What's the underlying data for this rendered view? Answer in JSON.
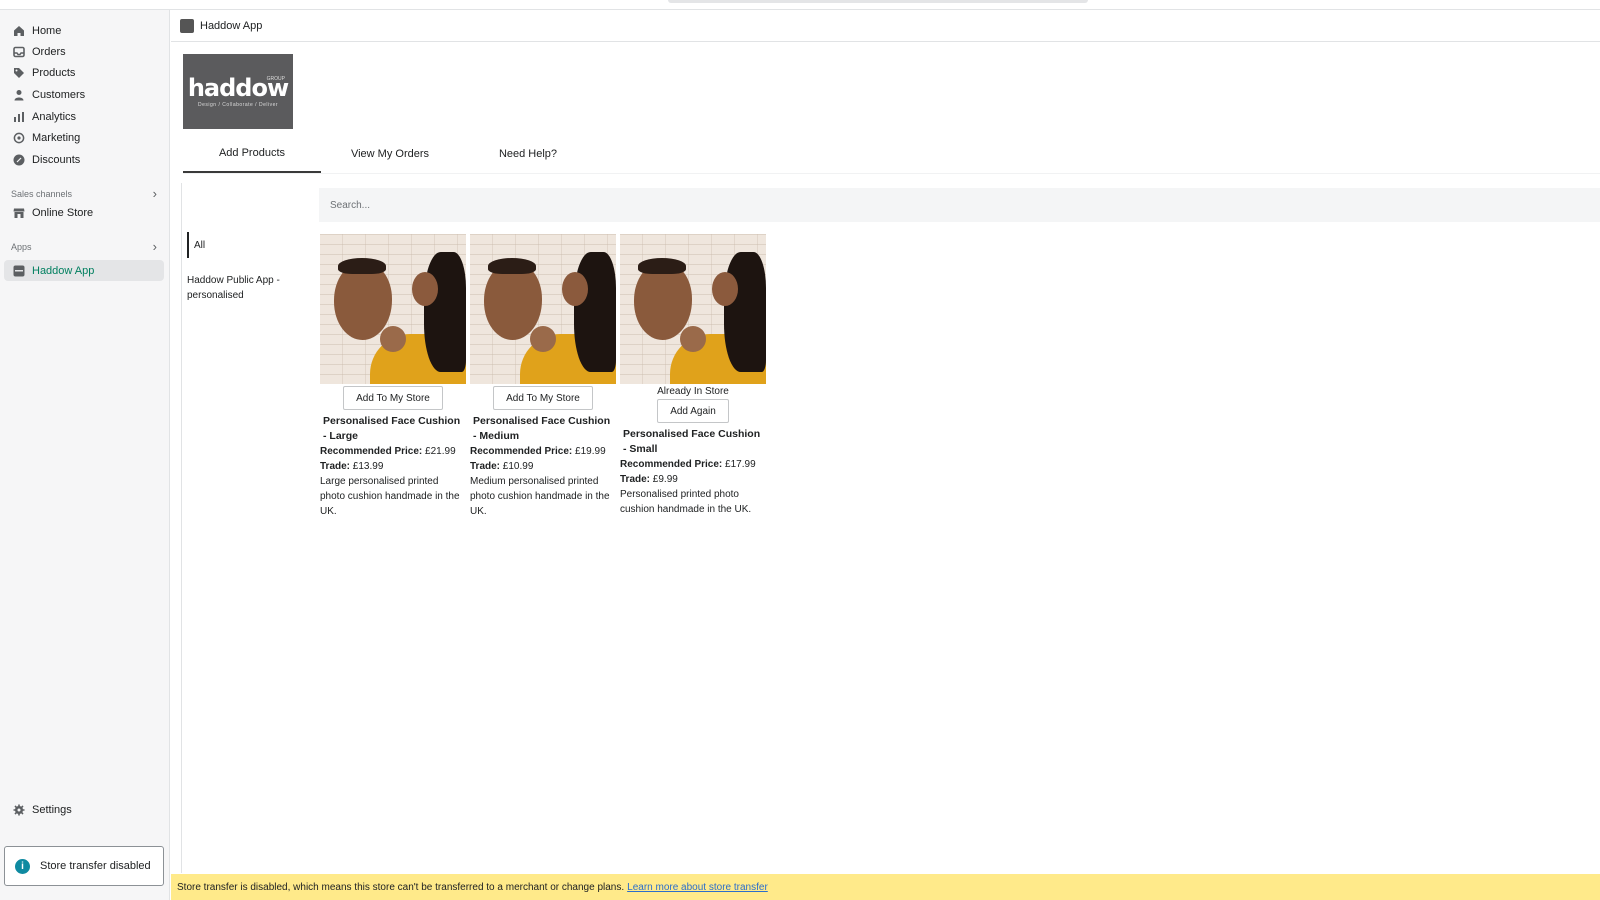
{
  "sidebar": {
    "items": [
      {
        "label": "Home",
        "icon": "home-icon"
      },
      {
        "label": "Orders",
        "icon": "orders-icon"
      },
      {
        "label": "Products",
        "icon": "tag-icon"
      },
      {
        "label": "Customers",
        "icon": "person-icon"
      },
      {
        "label": "Analytics",
        "icon": "bar-chart-icon"
      },
      {
        "label": "Marketing",
        "icon": "target-icon"
      },
      {
        "label": "Discounts",
        "icon": "discount-icon"
      }
    ],
    "sales_channels_label": "Sales channels",
    "online_store_label": "Online Store",
    "apps_label": "Apps",
    "haddow_app_label": "Haddow App",
    "settings_label": "Settings",
    "store_transfer_label": "Store transfer disabled",
    "active_color": "#007f5f"
  },
  "app_header": {
    "title": "Haddow App"
  },
  "logo": {
    "brand": "haddow",
    "group": "GROUP",
    "tagline": "Design / Collaborate / Deliver"
  },
  "tabs": [
    {
      "label": "Add Products",
      "active": true
    },
    {
      "label": "View My Orders",
      "active": false
    },
    {
      "label": "Need Help?",
      "active": false
    }
  ],
  "search": {
    "placeholder": "Search..."
  },
  "categories": [
    {
      "label": "All",
      "active": true
    },
    {
      "label": "Haddow Public App - personalised",
      "active": false
    }
  ],
  "products": [
    {
      "button_label": "Add To My Store",
      "status": "",
      "name": "Personalised Face Cushion - Large",
      "rec_label": "Recommended Price:",
      "rec_price": "£21.99",
      "trade_label": "Trade:",
      "trade_price": "£13.99",
      "description": "Large personalised printed photo cushion handmade in the UK."
    },
    {
      "button_label": "Add To My Store",
      "status": "",
      "name": "Personalised Face Cushion - Medium",
      "rec_label": "Recommended Price:",
      "rec_price": "£19.99",
      "trade_label": "Trade:",
      "trade_price": "£10.99",
      "description": "Medium personalised printed photo cushion handmade in the UK."
    },
    {
      "button_label": "Add Again",
      "status": "Already In Store",
      "name": "Personalised Face Cushion - Small",
      "rec_label": "Recommended Price:",
      "rec_price": "£17.99",
      "trade_label": "Trade:",
      "trade_price": "£9.99",
      "description": "Personalised printed photo cushion handmade in the UK."
    }
  ],
  "banner": {
    "text": "Store transfer is disabled, which means this store can't be transferred to a merchant or change plans.",
    "link": "Learn more about store transfer",
    "color": "#ffea8a"
  }
}
